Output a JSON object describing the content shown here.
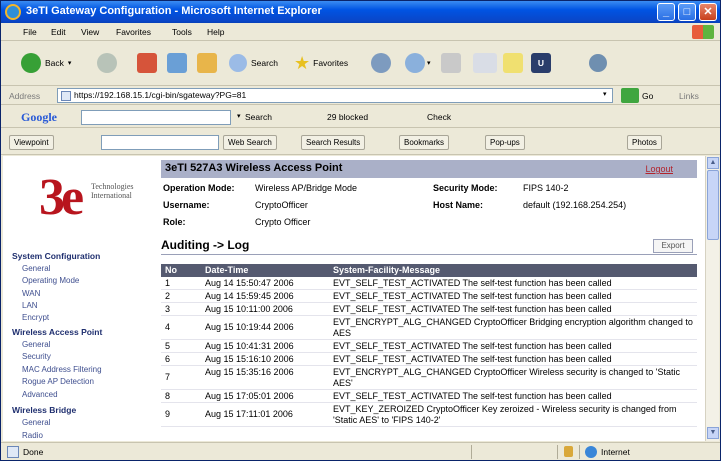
{
  "window": {
    "title": "3eTI Gateway Configuration - Microsoft Internet Explorer",
    "controls": {
      "minimize": "_",
      "maximize": "□",
      "close": "✕"
    }
  },
  "menu": [
    "File",
    "Edit",
    "View",
    "Favorites",
    "Tools",
    "Help"
  ],
  "toolbar": {
    "back": "Back",
    "search": "Search",
    "favorites": "Favorites"
  },
  "address": {
    "label": "Address",
    "url": "https://192.168.15.1/cgi-bin/sgateway?PG=81",
    "go": "Go",
    "links": "Links"
  },
  "google": {
    "logo": "Google",
    "search": "Search",
    "blocked": "29 blocked",
    "check": "Check"
  },
  "viewpoint": {
    "brand": "Viewpoint",
    "web_search": "Web Search",
    "search_results": "Search Results",
    "bookmarks": "Bookmarks",
    "popups": "Pop-ups",
    "photos": "Photos"
  },
  "logo": {
    "mark": "3e",
    "tagline_1": "Technologies",
    "tagline_2": "International"
  },
  "nav": {
    "system_config": "System Configuration",
    "system_items": [
      "General",
      "Operating Mode",
      "WAN",
      "LAN",
      "Encrypt"
    ],
    "wap": "Wireless Access Point",
    "wap_items": [
      "General",
      "Security",
      "MAC Address Filtering",
      "Rogue AP Detection",
      "Advanced"
    ],
    "bridge": "Wireless Bridge",
    "bridge_items": [
      "General",
      "Radio"
    ]
  },
  "device": {
    "title": "3eTI 527A3 Wireless Access Point",
    "logout": "Logout",
    "operation_mode_label": "Operation Mode:",
    "operation_mode": "Wireless AP/Bridge Mode",
    "username_label": "Username:",
    "username": "CryptoOfficer",
    "role_label": "Role:",
    "role": "Crypto Officer",
    "security_mode_label": "Security Mode:",
    "security_mode": "FIPS 140-2",
    "host_name_label": "Host Name:",
    "host_name": "default (192.168.254.254)"
  },
  "audit": {
    "heading": "Auditing -> Log",
    "export": "Export",
    "columns": [
      "No",
      "Date-Time",
      "System-Facility-Message"
    ],
    "rows": [
      {
        "no": "1",
        "time": "Aug 14 15:50:47 2006",
        "msg": "EVT_SELF_TEST_ACTIVATED The self-test function has been called"
      },
      {
        "no": "2",
        "time": "Aug 14 15:59:45 2006",
        "msg": "EVT_SELF_TEST_ACTIVATED The self-test function has been called"
      },
      {
        "no": "3",
        "time": "Aug 15 10:11:00 2006",
        "msg": "EVT_SELF_TEST_ACTIVATED The self-test function has been called"
      },
      {
        "no": "4",
        "time": "Aug 15 10:19:44 2006",
        "msg": "EVT_ENCRYPT_ALG_CHANGED CryptoOfficer Bridging encryption algorithm changed to AES"
      },
      {
        "no": "5",
        "time": "Aug 15 10:41:31 2006",
        "msg": "EVT_SELF_TEST_ACTIVATED The self-test function has been called"
      },
      {
        "no": "6",
        "time": "Aug 15 15:16:10 2006",
        "msg": "EVT_SELF_TEST_ACTIVATED The self-test function has been called"
      },
      {
        "no": "7",
        "time": "Aug 15 15:35:16 2006",
        "msg": "EVT_ENCRYPT_ALG_CHANGED CryptoOfficer Wireless security is changed to 'Static AES'"
      },
      {
        "no": "8",
        "time": "Aug 15 17:05:01 2006",
        "msg": "EVT_SELF_TEST_ACTIVATED The self-test function has been called"
      },
      {
        "no": "9",
        "time": "Aug 15 17:11:01 2006",
        "msg": "EVT_KEY_ZEROIZED CryptoOfficer Key zeroized - Wireless security is changed from 'Static AES' to 'FIPS 140-2'"
      }
    ]
  },
  "status": {
    "done": "Done",
    "zone": "Internet"
  }
}
